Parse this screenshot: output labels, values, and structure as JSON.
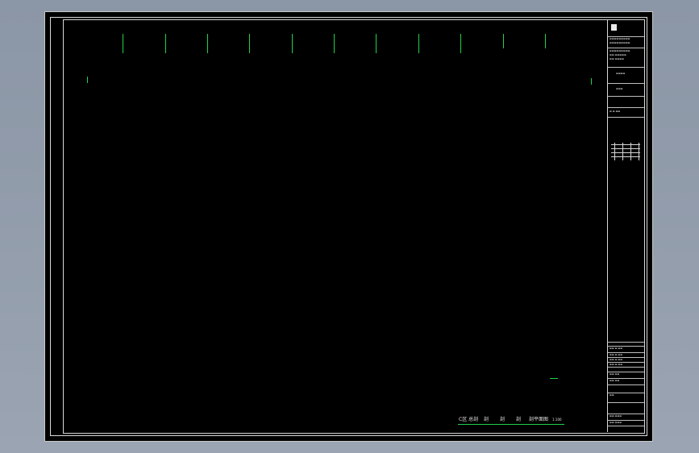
{
  "drawing": {
    "line_color": "#1fd14a",
    "frame_color": "#d8d8d8",
    "background": "#000000",
    "legend_items": [
      "C区 总剖",
      "剖",
      "剖",
      "剖",
      "剖平面图",
      "1:100"
    ]
  }
}
